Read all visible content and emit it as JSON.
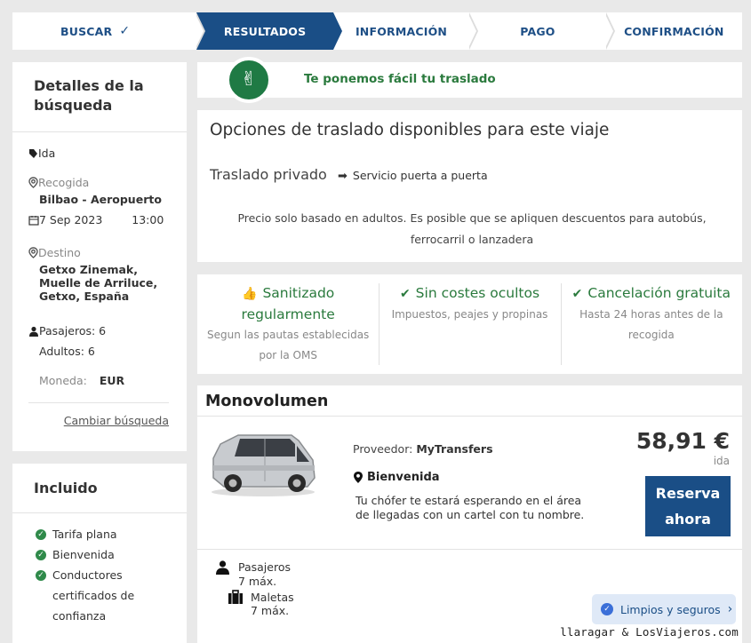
{
  "stepper": {
    "steps": [
      {
        "label": "BUSCAR",
        "done": true
      },
      {
        "label": "RESULTADOS",
        "active": true
      },
      {
        "label": "INFORMACIÓN"
      },
      {
        "label": "PAGO"
      },
      {
        "label": "CONFIRMACIÓN"
      }
    ],
    "check": "✓"
  },
  "search": {
    "title": "Detalles de la búsqueda",
    "trip": "Ida",
    "pickup_label": "Recogida",
    "pickup": "Bilbao - Aeropuerto",
    "date": "7 Sep 2023",
    "time": "13:00",
    "destination_label": "Destino",
    "destination": "Getxo Zinemak, Muelle de Arriluce, Getxo, España",
    "passengers": "Pasajeros: 6",
    "adults": "Adultos: 6",
    "currency_label": "Moneda:",
    "currency": "EUR",
    "change_link": "Cambiar búsqueda"
  },
  "included": {
    "title": "Incluido",
    "items": [
      "Tarifa plana",
      "Bienvenida",
      "Conductores certificados de confianza"
    ]
  },
  "banner": {
    "text": "Te ponemos fácil tu traslado"
  },
  "options": {
    "title": "Opciones de traslado disponibles para este viaje",
    "type": "Traslado privado",
    "door": "Servicio puerta a puerta",
    "note": "Precio solo basado en adultos. Es posible que se apliquen descuentos para autobús, ferrocarril o lanzadera"
  },
  "features": [
    {
      "title": "Sanitizado regularmente",
      "desc": "Segun las pautas establecidas por la OMS",
      "icon": "thumbs-up-icon"
    },
    {
      "title": "Sin costes ocultos",
      "desc": "Impuestos, peajes y propinas",
      "icon": "check-circle-icon"
    },
    {
      "title": "Cancelación gratuita",
      "desc": "Hasta 24 horas antes de la recogida",
      "icon": "check-circle-icon"
    }
  ],
  "vehicle": {
    "title": "Monovolumen",
    "provider_label": "Proveedor:",
    "provider": "MyTransfers",
    "welcome": "Bienvenida",
    "welcome_desc": "Tu chófer te estará esperando en el área de llegadas con un cartel con tu nombre.",
    "price": "58,91 €",
    "price_sub": "ida",
    "book": "Reserva ahora",
    "pax_label": "Pasajeros",
    "pax_value": "7 máx.",
    "bags_label": "Maletas",
    "bags_value": "7 máx."
  },
  "safety_pill": "Limpios y seguros",
  "watermark": "llaragar & LosViajeros.com",
  "colors": {
    "brand": "#1a4e86",
    "green": "#2a7a3d",
    "bg": "#e9e9e9"
  }
}
